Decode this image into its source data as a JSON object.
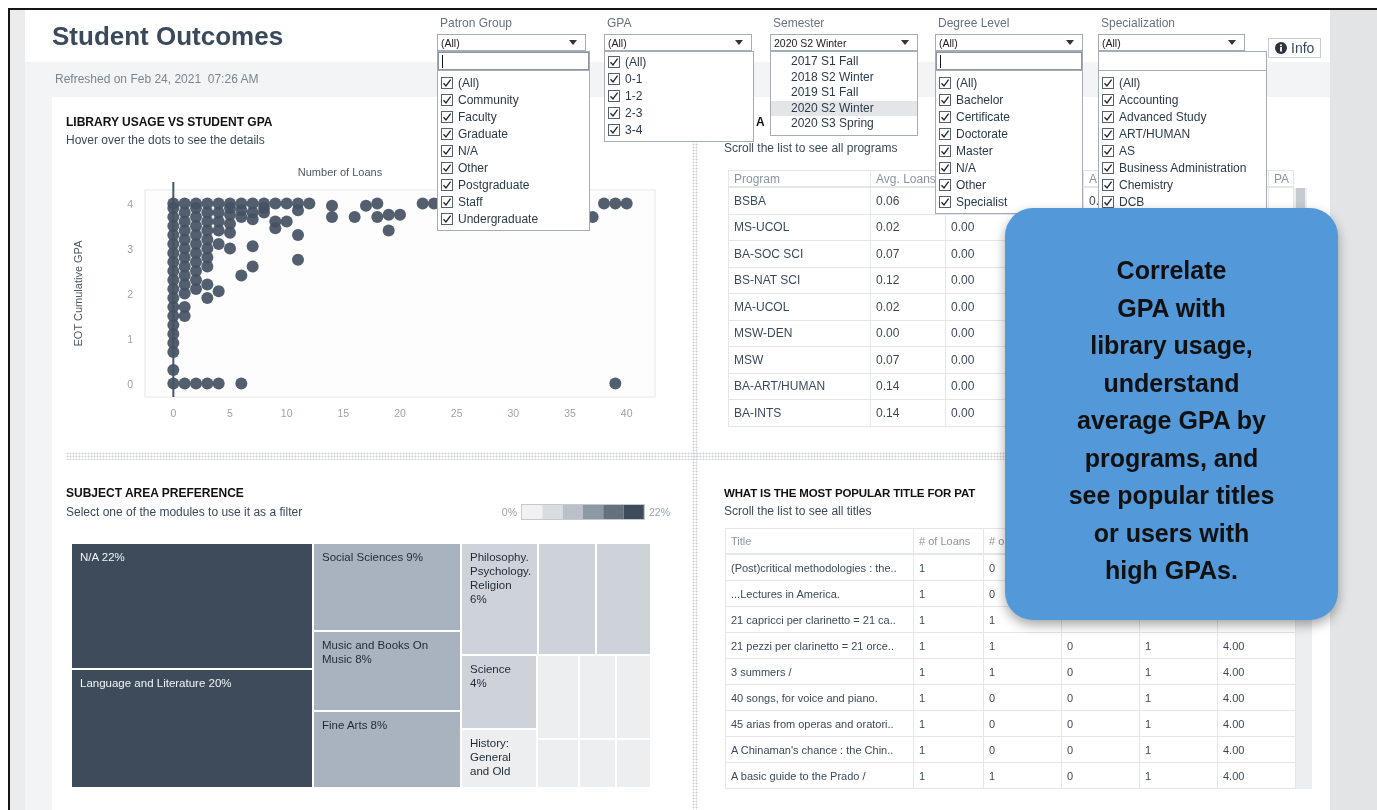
{
  "header": {
    "title": "Student Outcomes",
    "refreshed": "Refreshed on Feb 24, 2021  07:26 AM"
  },
  "filters": [
    {
      "label": "Patron Group",
      "kind": "multi",
      "value": "(All)",
      "search": {
        "focused": true
      },
      "options": [
        {
          "label": "(All)",
          "checked": true
        },
        {
          "label": "Community",
          "checked": true
        },
        {
          "label": "Faculty",
          "checked": true
        },
        {
          "label": "Graduate",
          "checked": true
        },
        {
          "label": "N/A",
          "checked": true
        },
        {
          "label": "Other",
          "checked": true
        },
        {
          "label": "Postgraduate",
          "checked": true
        },
        {
          "label": "Staff",
          "checked": true
        },
        {
          "label": "Undergraduate",
          "checked": true
        }
      ]
    },
    {
      "label": "GPA",
      "kind": "multi",
      "value": "(All)",
      "options": [
        {
          "label": "(All)",
          "checked": true
        },
        {
          "label": "0-1",
          "checked": true
        },
        {
          "label": "1-2",
          "checked": true
        },
        {
          "label": "2-3",
          "checked": true
        },
        {
          "label": "3-4",
          "checked": true
        }
      ]
    },
    {
      "label": "Semester",
      "kind": "single",
      "value": "2020 S2 Winter",
      "options": [
        {
          "label": "2017 S1 Fall",
          "selected": false
        },
        {
          "label": "2018 S2 Winter",
          "selected": false
        },
        {
          "label": "2019 S1 Fall",
          "selected": false
        },
        {
          "label": "2020 S2 Winter",
          "selected": true
        },
        {
          "label": "2020 S3 Spring",
          "selected": false
        }
      ]
    },
    {
      "label": "Degree Level",
      "kind": "multi",
      "value": "(All)",
      "search": {
        "focused": true
      },
      "options": [
        {
          "label": "(All)",
          "checked": true
        },
        {
          "label": "Bachelor",
          "checked": true
        },
        {
          "label": "Certificate",
          "checked": true
        },
        {
          "label": "Doctorate",
          "checked": true
        },
        {
          "label": "Master",
          "checked": true
        },
        {
          "label": "N/A",
          "checked": true
        },
        {
          "label": "Other",
          "checked": true
        },
        {
          "label": "Specialist",
          "checked": true
        }
      ]
    },
    {
      "label": "Specialization",
      "kind": "multi",
      "value": "(All)",
      "search": {
        "focused": false
      },
      "options": [
        {
          "label": "(All)",
          "checked": true
        },
        {
          "label": "Accounting",
          "checked": true
        },
        {
          "label": "Advanced Study",
          "checked": true
        },
        {
          "label": "ART/HUMAN",
          "checked": true
        },
        {
          "label": "AS",
          "checked": true
        },
        {
          "label": "Business Administration",
          "checked": true
        },
        {
          "label": "Chemistry",
          "checked": true
        },
        {
          "label": "DCB",
          "checked": true
        }
      ]
    }
  ],
  "info_button": {
    "label": "Info"
  },
  "usage_chart": {
    "title": "LIBRARY USAGE VS STUDENT GPA",
    "subtitle": "Hover over the dots to see the details",
    "chart_data": {
      "type": "scatter",
      "xlabel": "Number of Loans",
      "ylabel": "EOT Cumulative GPA",
      "xlim": [
        -2.5,
        42.5
      ],
      "ylim": [
        -0.3,
        4.3
      ],
      "xticks": [
        0,
        5,
        10,
        15,
        20,
        25,
        30,
        35,
        40
      ],
      "yticks": [
        0,
        1,
        2,
        3,
        4
      ],
      "x": [
        0,
        0,
        0,
        0,
        0,
        0,
        0,
        0,
        0,
        0,
        0,
        0,
        0,
        0,
        0,
        0,
        0,
        0,
        0,
        0,
        1,
        1,
        1,
        1,
        1,
        1,
        1,
        1,
        1,
        1,
        1,
        1,
        1,
        1,
        2,
        2,
        2,
        2,
        2,
        2,
        2,
        2,
        2,
        2,
        2,
        2,
        3,
        3,
        3,
        3,
        3,
        3,
        3,
        3,
        3,
        3,
        3,
        4,
        4,
        4,
        4,
        4,
        4,
        4,
        5,
        5,
        5,
        5,
        5,
        5,
        6,
        6,
        6,
        6,
        6,
        7,
        7,
        7,
        7,
        7,
        8,
        8,
        8,
        9,
        9,
        9,
        10,
        10,
        11,
        11,
        11,
        11,
        12,
        14,
        14,
        16,
        17,
        18,
        18,
        19,
        19,
        20,
        22,
        23,
        37,
        38,
        39,
        39,
        40
      ],
      "values": [
        0,
        0.3,
        0.7,
        0.9,
        1.1,
        1.3,
        1.5,
        1.7,
        1.9,
        2.1,
        2.3,
        2.5,
        2.7,
        2.9,
        3.1,
        3.3,
        3.5,
        3.7,
        3.9,
        4,
        0,
        1.5,
        1.7,
        2,
        2.2,
        2.4,
        2.6,
        2.8,
        3,
        3.2,
        3.4,
        3.6,
        3.8,
        4,
        0,
        2.1,
        2.3,
        2.5,
        2.7,
        2.9,
        3.1,
        3.3,
        3.5,
        3.7,
        3.9,
        4,
        0,
        1.9,
        2.2,
        2.6,
        2.8,
        3,
        3.2,
        3.4,
        3.6,
        3.8,
        4,
        0,
        2.05,
        3.1,
        3.4,
        3.6,
        3.8,
        4,
        3,
        3.35,
        3.55,
        3.75,
        3.9,
        4,
        0,
        2.4,
        3.7,
        3.85,
        4,
        2.6,
        3.05,
        3.65,
        3.8,
        4,
        3.8,
        3.9,
        4,
        3.45,
        3.6,
        4,
        3.6,
        4,
        2.75,
        3.3,
        3.85,
        4,
        4,
        3.7,
        3.95,
        3.7,
        3.95,
        3.7,
        4,
        3.4,
        3.75,
        3.75,
        4,
        4,
        3.7,
        4,
        4,
        0,
        4
      ]
    }
  },
  "programs": {
    "title": "A",
    "subtitle": "Scroll the list to see all programs",
    "columns": [
      "Program",
      "Avg. Loans",
      null,
      "A",
      "PA"
    ],
    "rows": [
      [
        "BSBA",
        "0.06",
        null,
        "0."
      ],
      [
        "MS-UCOL",
        "0.02",
        "0.00"
      ],
      [
        "BA-SOC SCI",
        "0.07",
        "0.00"
      ],
      [
        "BS-NAT SCI",
        "0.12",
        "0.00"
      ],
      [
        "MA-UCOL",
        "0.02",
        "0.00"
      ],
      [
        "MSW-DEN",
        "0.00",
        "0.00"
      ],
      [
        "MSW",
        "0.07",
        "0.00"
      ],
      [
        "BA-ART/HUMAN",
        "0.14",
        "0.00"
      ],
      [
        "BA-INTS",
        "0.14",
        "0.00"
      ]
    ]
  },
  "subjects": {
    "title": "SUBJECT AREA PREFERENCE",
    "subtitle": "Select one of the modules to use it as a filter",
    "legend": {
      "min": "0%",
      "max": "22%"
    },
    "cells": [
      {
        "label": "N/A 22%",
        "color": "#3d4b5b"
      },
      {
        "label": "Language and Literature 20%",
        "color": "#3d4b5b"
      },
      {
        "label": "Social Sciences 9%",
        "color": "#a9b3bf"
      },
      {
        "label": "Music and Books On Music 8%",
        "color": "#a9b3bf"
      },
      {
        "label": "Fine Arts 8%",
        "color": "#a9b3bf"
      },
      {
        "label": "Philosophy. Psychology. Religion 6%",
        "color": "#ced3da"
      },
      {
        "color": "#ced3da"
      },
      {
        "color": "#ced3da"
      },
      {
        "label": "Science 4%",
        "color": "#ced3da"
      },
      {
        "label": "History: General and Old",
        "color": "#eceef0"
      },
      {
        "color": "#eceef0"
      },
      {
        "color": "#eceef0"
      },
      {
        "color": "#eceef0"
      },
      {
        "color": "#eceef0"
      },
      {
        "color": "#eceef0"
      },
      {
        "color": "#eceef0"
      }
    ]
  },
  "titles": {
    "title": "WHAT IS THE MOST POPULAR TITLE FOR PAT",
    "subtitle": "Scroll the list to see all titles",
    "columns": [
      "Title",
      "# of Loans",
      "# o"
    ],
    "rows": [
      [
        "(Post)critical methodologies : the..",
        "1",
        "0"
      ],
      [
        "...Lectures in America.",
        "1",
        "0"
      ],
      [
        "21 capricci per clarinetto = 21 ca..",
        "1",
        "1"
      ],
      [
        "21 pezzi per clarinetto = 21 orce..",
        "1",
        "1",
        "0",
        "1",
        "4.00"
      ],
      [
        "3 summers /",
        "1",
        "1",
        "0",
        "1",
        "4.00"
      ],
      [
        "40 songs, for voice and piano.",
        "1",
        "0",
        "0",
        "1",
        "4.00"
      ],
      [
        "45 arias from operas and oratori..",
        "1",
        "0",
        "0",
        "1",
        "4.00"
      ],
      [
        "A Chinaman's chance : the Chin..",
        "1",
        "0",
        "0",
        "1",
        "4.00"
      ],
      [
        "A basic guide to the Prado /",
        "1",
        "1",
        "0",
        "1",
        "4.00"
      ]
    ]
  },
  "callout": {
    "text": "Correlate\nGPA with\nlibrary usage,\nunderstand\naverage GPA by\nprograms, and\nsee popular titles\nor users with\nhigh GPAs."
  }
}
